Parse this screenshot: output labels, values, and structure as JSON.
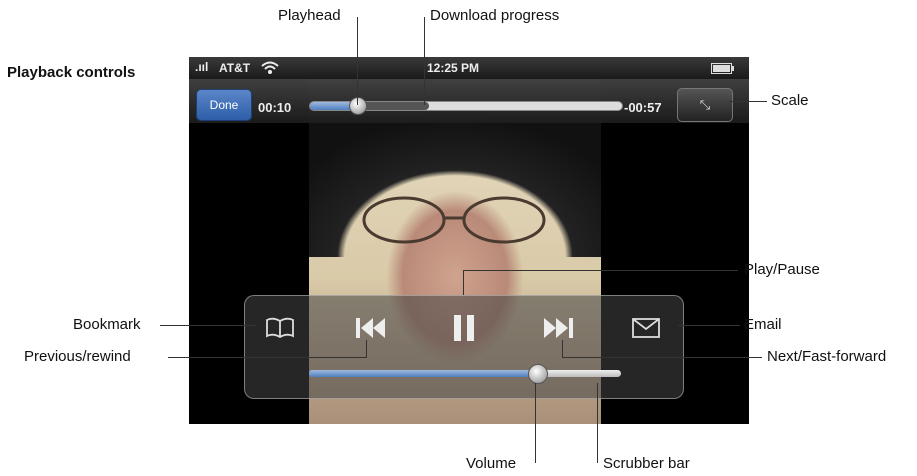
{
  "section_title": "Playback controls",
  "status_bar": {
    "carrier": "AT&T",
    "time": "12:25 PM"
  },
  "top_bar": {
    "done_label": "Done",
    "elapsed": "00:10",
    "remaining": "-00:57",
    "playhead_fraction": 0.15,
    "download_fraction": 0.38
  },
  "controls": {
    "volume_fraction": 0.73
  },
  "callouts": {
    "playhead": "Playhead",
    "download_progress": "Download progress",
    "scale": "Scale",
    "play_pause": "Play/Pause",
    "bookmark": "Bookmark",
    "email": "Email",
    "previous_rewind": "Previous/rewind",
    "next_fast_forward": "Next/Fast-forward",
    "volume": "Volume",
    "scrubber_bar": "Scrubber bar"
  }
}
